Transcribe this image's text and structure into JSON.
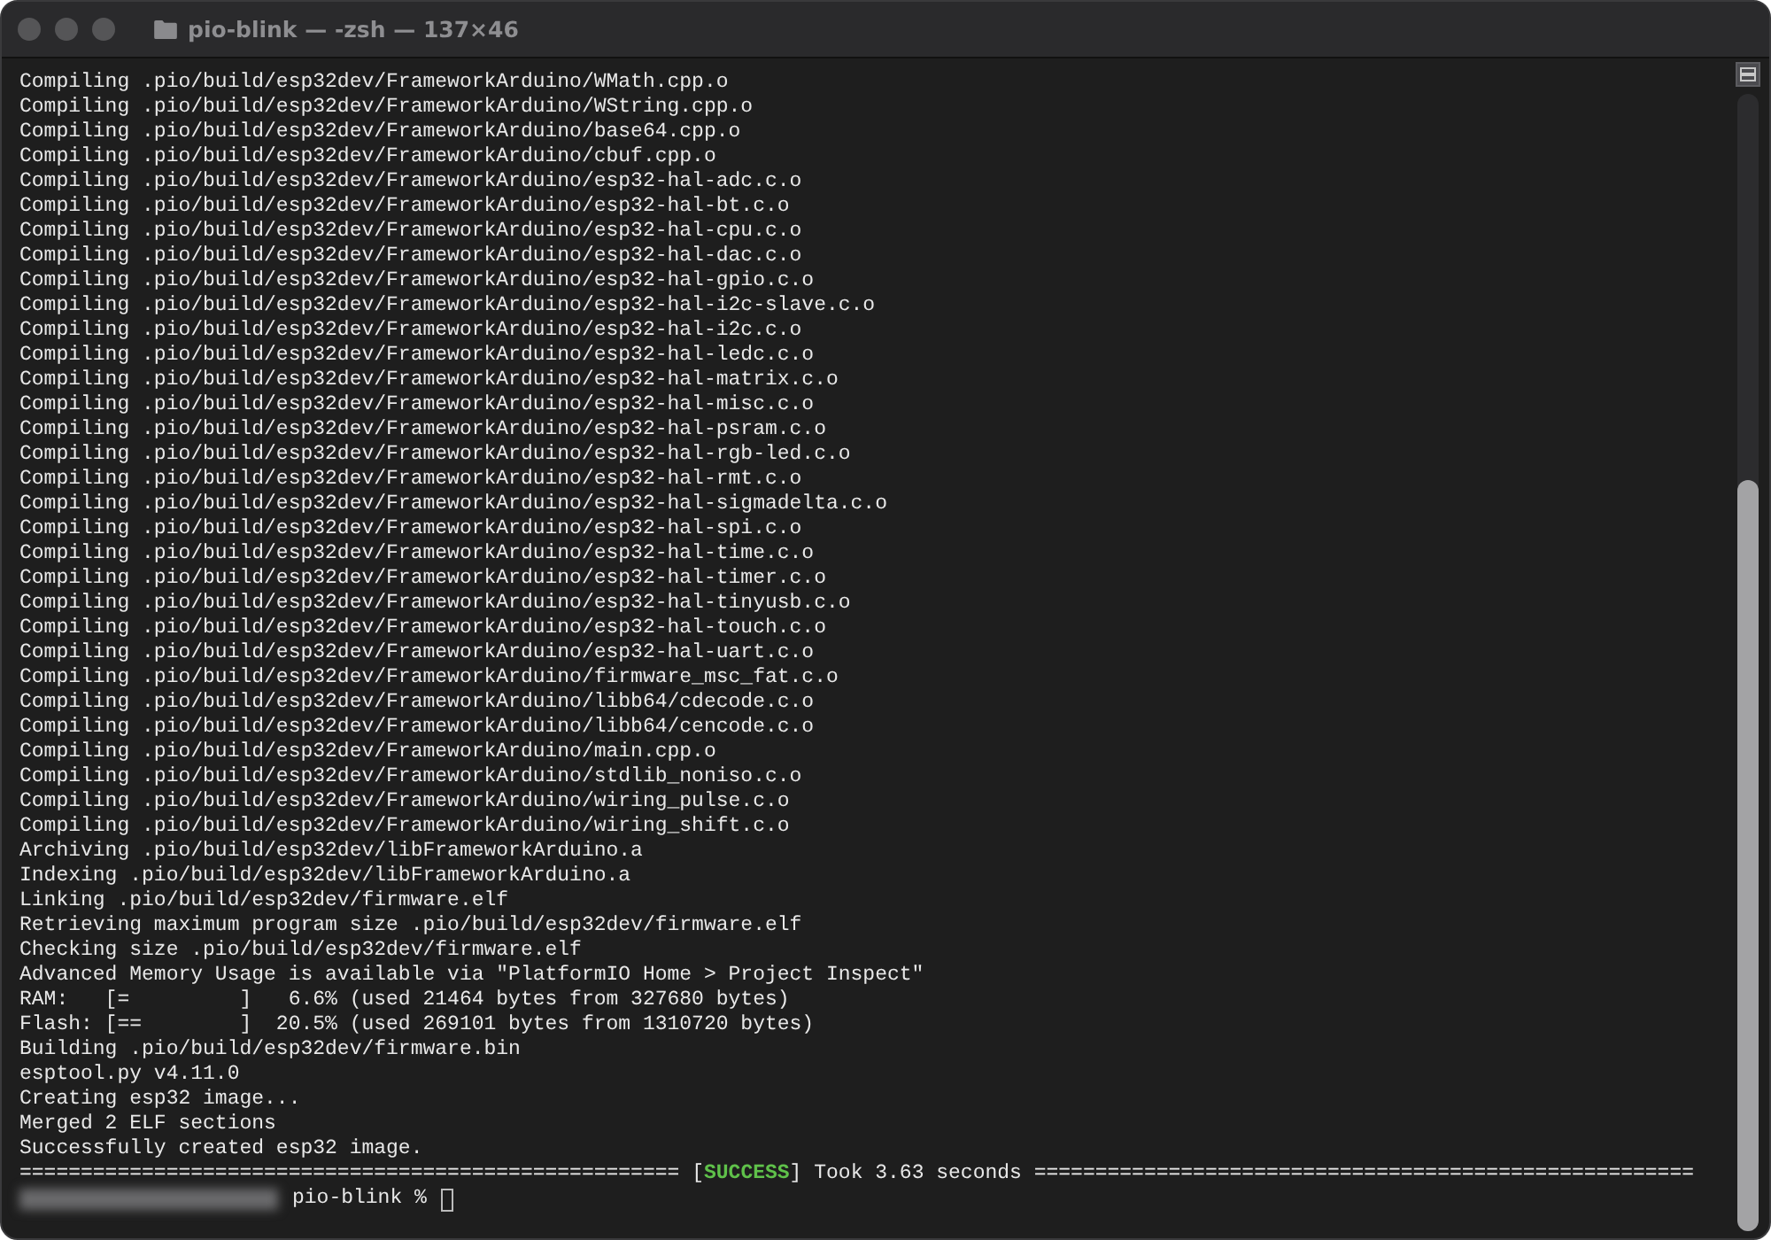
{
  "window": {
    "title": "pio-blink — -zsh — 137×46"
  },
  "terminal": {
    "lines": [
      {
        "kind": "text",
        "text": "Compiling .pio/build/esp32dev/FrameworkArduino/WMath.cpp.o"
      },
      {
        "kind": "text",
        "text": "Compiling .pio/build/esp32dev/FrameworkArduino/WString.cpp.o"
      },
      {
        "kind": "text",
        "text": "Compiling .pio/build/esp32dev/FrameworkArduino/base64.cpp.o"
      },
      {
        "kind": "text",
        "text": "Compiling .pio/build/esp32dev/FrameworkArduino/cbuf.cpp.o"
      },
      {
        "kind": "text",
        "text": "Compiling .pio/build/esp32dev/FrameworkArduino/esp32-hal-adc.c.o"
      },
      {
        "kind": "text",
        "text": "Compiling .pio/build/esp32dev/FrameworkArduino/esp32-hal-bt.c.o"
      },
      {
        "kind": "text",
        "text": "Compiling .pio/build/esp32dev/FrameworkArduino/esp32-hal-cpu.c.o"
      },
      {
        "kind": "text",
        "text": "Compiling .pio/build/esp32dev/FrameworkArduino/esp32-hal-dac.c.o"
      },
      {
        "kind": "text",
        "text": "Compiling .pio/build/esp32dev/FrameworkArduino/esp32-hal-gpio.c.o"
      },
      {
        "kind": "text",
        "text": "Compiling .pio/build/esp32dev/FrameworkArduino/esp32-hal-i2c-slave.c.o"
      },
      {
        "kind": "text",
        "text": "Compiling .pio/build/esp32dev/FrameworkArduino/esp32-hal-i2c.c.o"
      },
      {
        "kind": "text",
        "text": "Compiling .pio/build/esp32dev/FrameworkArduino/esp32-hal-ledc.c.o"
      },
      {
        "kind": "text",
        "text": "Compiling .pio/build/esp32dev/FrameworkArduino/esp32-hal-matrix.c.o"
      },
      {
        "kind": "text",
        "text": "Compiling .pio/build/esp32dev/FrameworkArduino/esp32-hal-misc.c.o"
      },
      {
        "kind": "text",
        "text": "Compiling .pio/build/esp32dev/FrameworkArduino/esp32-hal-psram.c.o"
      },
      {
        "kind": "text",
        "text": "Compiling .pio/build/esp32dev/FrameworkArduino/esp32-hal-rgb-led.c.o"
      },
      {
        "kind": "text",
        "text": "Compiling .pio/build/esp32dev/FrameworkArduino/esp32-hal-rmt.c.o"
      },
      {
        "kind": "text",
        "text": "Compiling .pio/build/esp32dev/FrameworkArduino/esp32-hal-sigmadelta.c.o"
      },
      {
        "kind": "text",
        "text": "Compiling .pio/build/esp32dev/FrameworkArduino/esp32-hal-spi.c.o"
      },
      {
        "kind": "text",
        "text": "Compiling .pio/build/esp32dev/FrameworkArduino/esp32-hal-time.c.o"
      },
      {
        "kind": "text",
        "text": "Compiling .pio/build/esp32dev/FrameworkArduino/esp32-hal-timer.c.o"
      },
      {
        "kind": "text",
        "text": "Compiling .pio/build/esp32dev/FrameworkArduino/esp32-hal-tinyusb.c.o"
      },
      {
        "kind": "text",
        "text": "Compiling .pio/build/esp32dev/FrameworkArduino/esp32-hal-touch.c.o"
      },
      {
        "kind": "text",
        "text": "Compiling .pio/build/esp32dev/FrameworkArduino/esp32-hal-uart.c.o"
      },
      {
        "kind": "text",
        "text": "Compiling .pio/build/esp32dev/FrameworkArduino/firmware_msc_fat.c.o"
      },
      {
        "kind": "text",
        "text": "Compiling .pio/build/esp32dev/FrameworkArduino/libb64/cdecode.c.o"
      },
      {
        "kind": "text",
        "text": "Compiling .pio/build/esp32dev/FrameworkArduino/libb64/cencode.c.o"
      },
      {
        "kind": "text",
        "text": "Compiling .pio/build/esp32dev/FrameworkArduino/main.cpp.o"
      },
      {
        "kind": "text",
        "text": "Compiling .pio/build/esp32dev/FrameworkArduino/stdlib_noniso.c.o"
      },
      {
        "kind": "text",
        "text": "Compiling .pio/build/esp32dev/FrameworkArduino/wiring_pulse.c.o"
      },
      {
        "kind": "text",
        "text": "Compiling .pio/build/esp32dev/FrameworkArduino/wiring_shift.c.o"
      },
      {
        "kind": "text",
        "text": "Archiving .pio/build/esp32dev/libFrameworkArduino.a"
      },
      {
        "kind": "text",
        "text": "Indexing .pio/build/esp32dev/libFrameworkArduino.a"
      },
      {
        "kind": "text",
        "text": "Linking .pio/build/esp32dev/firmware.elf"
      },
      {
        "kind": "text",
        "text": "Retrieving maximum program size .pio/build/esp32dev/firmware.elf"
      },
      {
        "kind": "text",
        "text": "Checking size .pio/build/esp32dev/firmware.elf"
      },
      {
        "kind": "text",
        "text": "Advanced Memory Usage is available via \"PlatformIO Home > Project Inspect\""
      },
      {
        "kind": "text",
        "text": "RAM:   [=         ]   6.6% (used 21464 bytes from 327680 bytes)"
      },
      {
        "kind": "text",
        "text": "Flash: [==        ]  20.5% (used 269101 bytes from 1310720 bytes)"
      },
      {
        "kind": "text",
        "text": "Building .pio/build/esp32dev/firmware.bin"
      },
      {
        "kind": "text",
        "text": "esptool.py v4.11.0"
      },
      {
        "kind": "text",
        "text": "Creating esp32 image..."
      },
      {
        "kind": "text",
        "text": "Merged 2 ELF sections"
      },
      {
        "kind": "text",
        "text": "Successfully created esp32 image."
      },
      {
        "kind": "result",
        "rule_left": "======================================================",
        "open": "[",
        "tag": "SUCCESS",
        "close": "]",
        "message": "Took 3.63 seconds",
        "rule_right": "======================================================"
      }
    ],
    "prompt": {
      "text": "pio-blink %"
    }
  }
}
